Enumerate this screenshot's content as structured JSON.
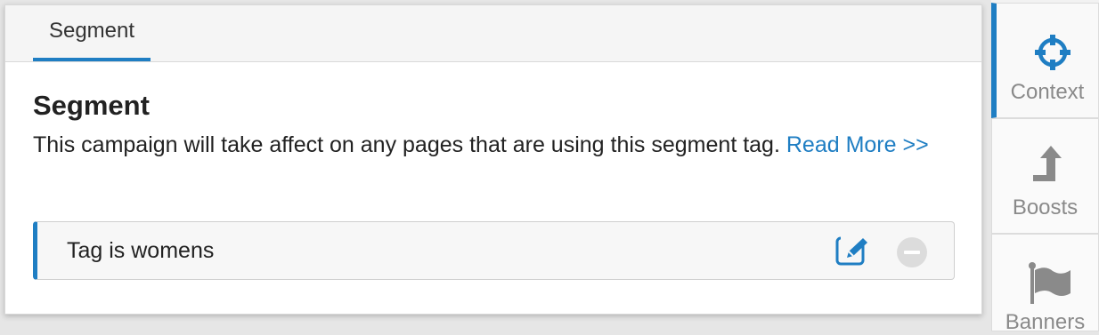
{
  "tabs": [
    {
      "label": "Segment"
    }
  ],
  "section": {
    "title": "Segment",
    "description": "This campaign will take affect on any pages that are using this segment tag.",
    "link_text": "Read More >>"
  },
  "tag_row": {
    "label": "Tag is womens",
    "edit_icon": "edit-icon",
    "remove_icon": "remove-icon"
  },
  "side_nav": {
    "items": [
      {
        "label": "Context",
        "icon": "crosshair-icon",
        "active": true
      },
      {
        "label": "Boosts",
        "icon": "boost-arrow-icon",
        "active": false
      },
      {
        "label": "Banners",
        "icon": "flag-icon",
        "active": false
      }
    ]
  },
  "colors": {
    "accent": "#1f7ec3",
    "muted": "#8a8a8a"
  }
}
